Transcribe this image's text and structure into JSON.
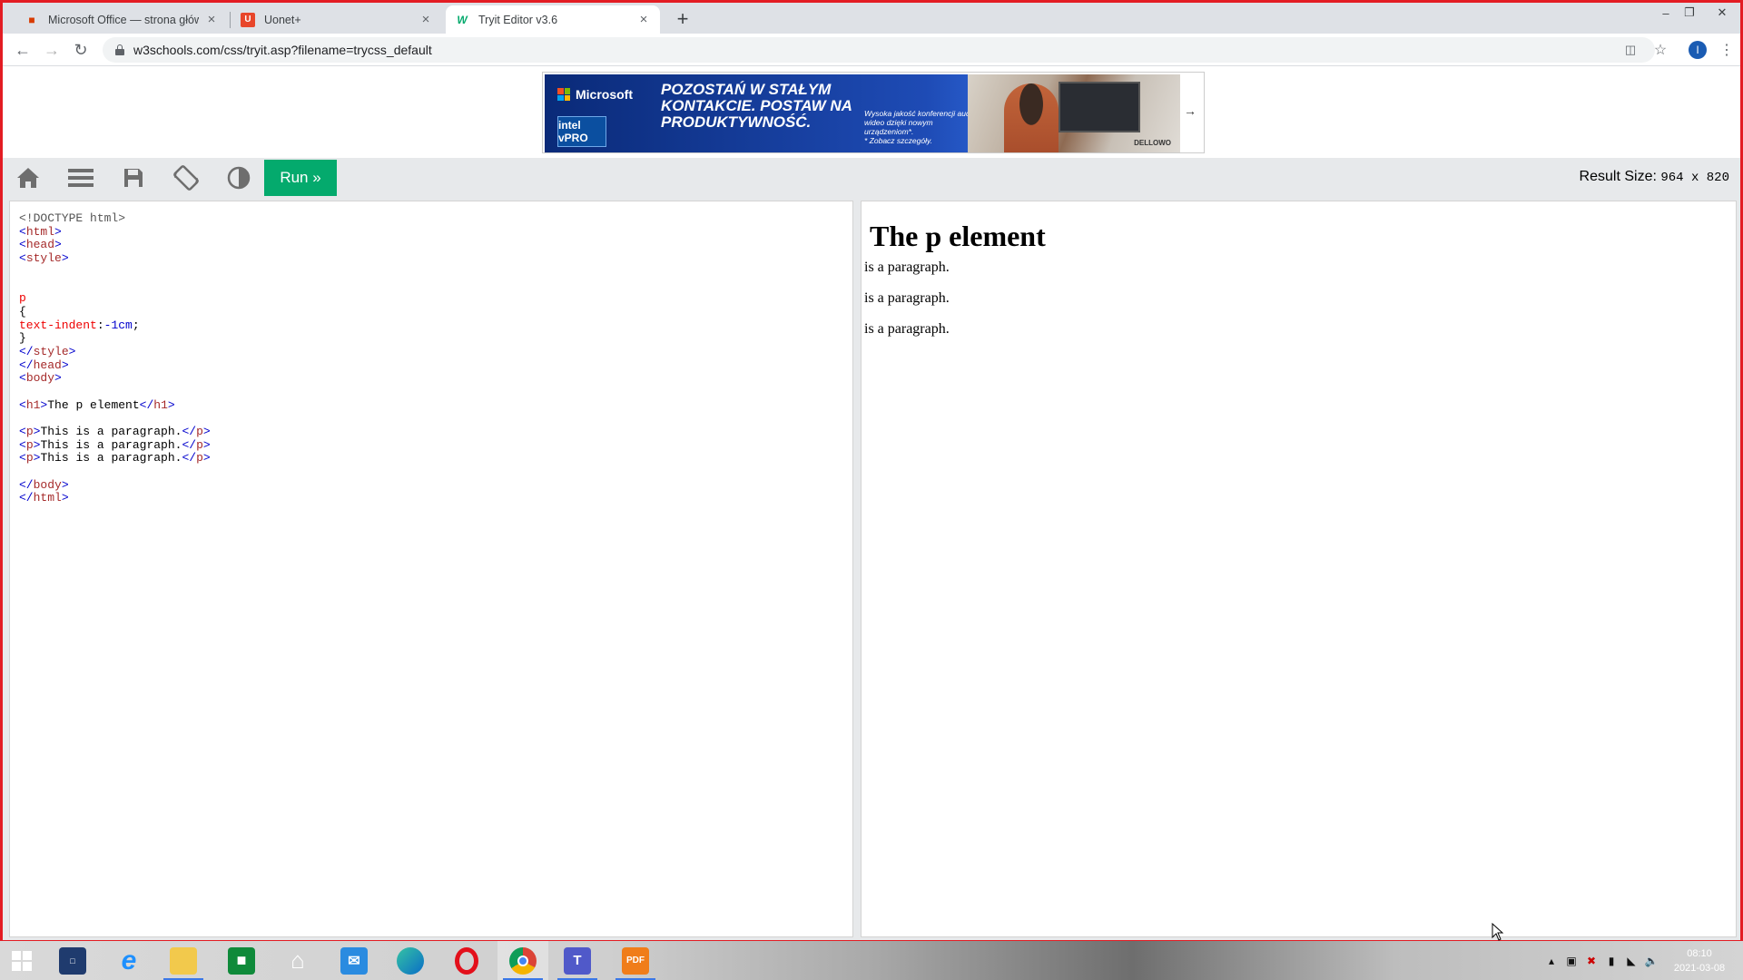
{
  "browser": {
    "tabs": [
      {
        "title": "Microsoft Office — strona główna",
        "favicon": "office-icon"
      },
      {
        "title": "Uonet+",
        "favicon": "uonet-icon"
      },
      {
        "title": "Tryit Editor v3.6",
        "favicon": "w3schools-icon"
      }
    ],
    "active_tab": 2,
    "url": "w3schools.com/css/tryit.asp?filename=trycss_default",
    "profile_initial": "I",
    "window_controls": [
      "minimize",
      "restore",
      "close"
    ]
  },
  "ad": {
    "brand": "Microsoft",
    "intel_badge": "intel vPRO",
    "headline": "POZOSTAŃ W STAŁYM KONTAKCIE. POSTAW NA PRODUKTYWNOŚĆ.",
    "subtext": "Wysoka jakość konferencji audio i wideo dzięki nowym urządzeniom*.",
    "footnote": "* Zobacz szczegóły.",
    "partner": "DELLOWO",
    "arrow": "→"
  },
  "tryit": {
    "run_label": "Run »",
    "result_size_label": "Result Size:",
    "result_size_value": "964 x 820",
    "toolbar_icons": [
      "home-icon",
      "menu-icon",
      "save-icon",
      "rotate-icon",
      "contrast-icon"
    ]
  },
  "code_lines": [
    "<!DOCTYPE html>",
    "<html>",
    "<head>",
    "<style>",
    "",
    "",
    "p",
    "{",
    "text-indent:-1cm;",
    "}",
    "</style>",
    "</head>",
    "<body>",
    "",
    "<h1>The p element</h1>",
    "",
    "<p>This is a paragraph.</p>",
    "<p>This is a paragraph.</p>",
    "<p>This is a paragraph.</p>",
    "",
    "</body>",
    "</html>"
  ],
  "result": {
    "heading": "The p element",
    "paragraphs": [
      "is a paragraph.",
      "is a paragraph.",
      "is a paragraph."
    ]
  },
  "taskbar": {
    "apps": [
      "start-icon",
      "lenovo-vantage-icon",
      "internet-explorer-icon",
      "file-explorer-icon",
      "store-icon",
      "home-icon",
      "mail-icon",
      "edge-icon",
      "opera-icon",
      "chrome-icon",
      "teams-icon",
      "pdf-icon"
    ],
    "pdf_label": "PDF",
    "clock_time": "08:10",
    "clock_date": "2021-03-08"
  }
}
